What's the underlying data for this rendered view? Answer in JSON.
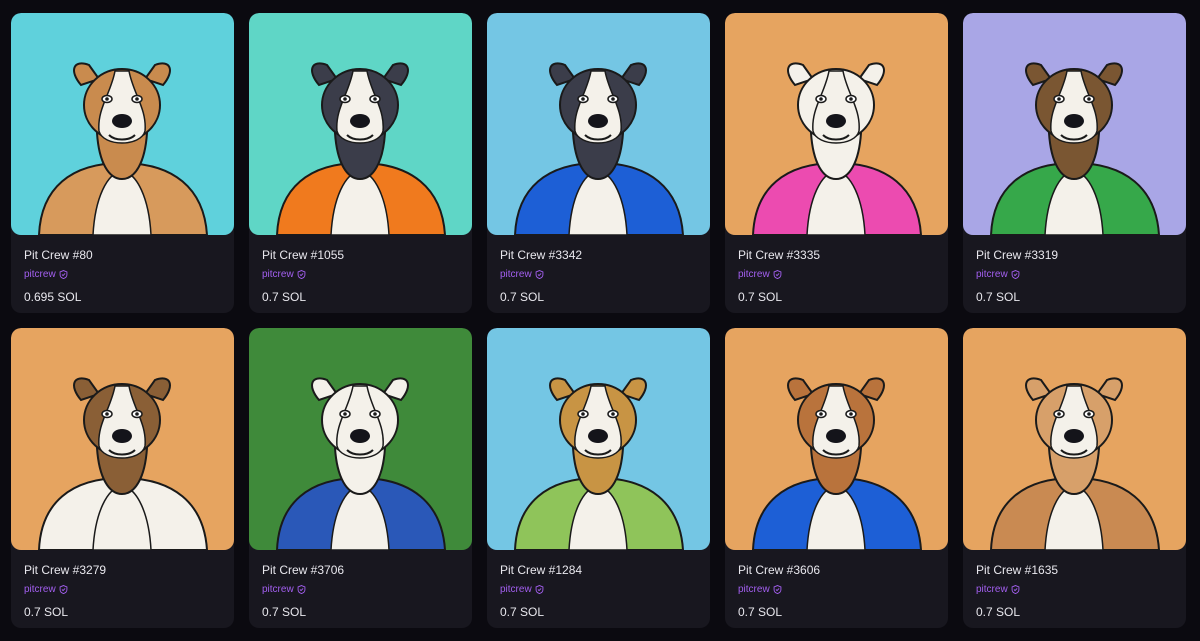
{
  "listings": [
    {
      "name": "Pit Crew #80",
      "collection": "pitcrew",
      "price": "0.695 SOL",
      "bg": "#5fd1dc",
      "fur": "#c98b4e",
      "outfit": "#d79a5c",
      "prop": "propeller-hat-icon"
    },
    {
      "name": "Pit Crew #1055",
      "collection": "pitcrew",
      "price": "0.7 SOL",
      "bg": "#5fd6c6",
      "fur": "#3b3d4a",
      "outfit": "#f07a1e",
      "prop": "firefighter-jacket-icon"
    },
    {
      "name": "Pit Crew #3342",
      "collection": "pitcrew",
      "price": "0.7 SOL",
      "bg": "#74c6e4",
      "fur": "#3b3d4a",
      "outfit": "#1d5fd6",
      "prop": "monocle-icon"
    },
    {
      "name": "Pit Crew #3335",
      "collection": "pitcrew",
      "price": "0.7 SOL",
      "bg": "#e6a460",
      "fur": "#f4f1ea",
      "outfit": "#ec4bb0",
      "prop": "striped-shirt-icon"
    },
    {
      "name": "Pit Crew #3319",
      "collection": "pitcrew",
      "price": "0.7 SOL",
      "bg": "#a9a6e6",
      "fur": "#7a5632",
      "outfit": "#36a84a",
      "prop": "vest-icon"
    },
    {
      "name": "Pit Crew #3279",
      "collection": "pitcrew",
      "price": "0.7 SOL",
      "bg": "#e6a460",
      "fur": "#8a5f36",
      "outfit": "#f4f1ea",
      "prop": "sunglasses-icon"
    },
    {
      "name": "Pit Crew #3706",
      "collection": "pitcrew",
      "price": "0.7 SOL",
      "bg": "#3f8a3a",
      "fur": "#f4f1ea",
      "outfit": "#2a58b8",
      "prop": "overalls-icon"
    },
    {
      "name": "Pit Crew #1284",
      "collection": "pitcrew",
      "price": "0.7 SOL",
      "bg": "#74c6e4",
      "fur": "#c89444",
      "outfit": "#8fc45a",
      "prop": "camo-jacket-icon"
    },
    {
      "name": "Pit Crew #3606",
      "collection": "pitcrew",
      "price": "0.7 SOL",
      "bg": "#e6a460",
      "fur": "#b9733c",
      "outfit": "#1d5fd6",
      "prop": "bowtie-icon"
    },
    {
      "name": "Pit Crew #1635",
      "collection": "pitcrew",
      "price": "0.7 SOL",
      "bg": "#e6a460",
      "fur": "#d7a06a",
      "outfit": "#c98a52",
      "prop": "tattoo-icon"
    }
  ]
}
